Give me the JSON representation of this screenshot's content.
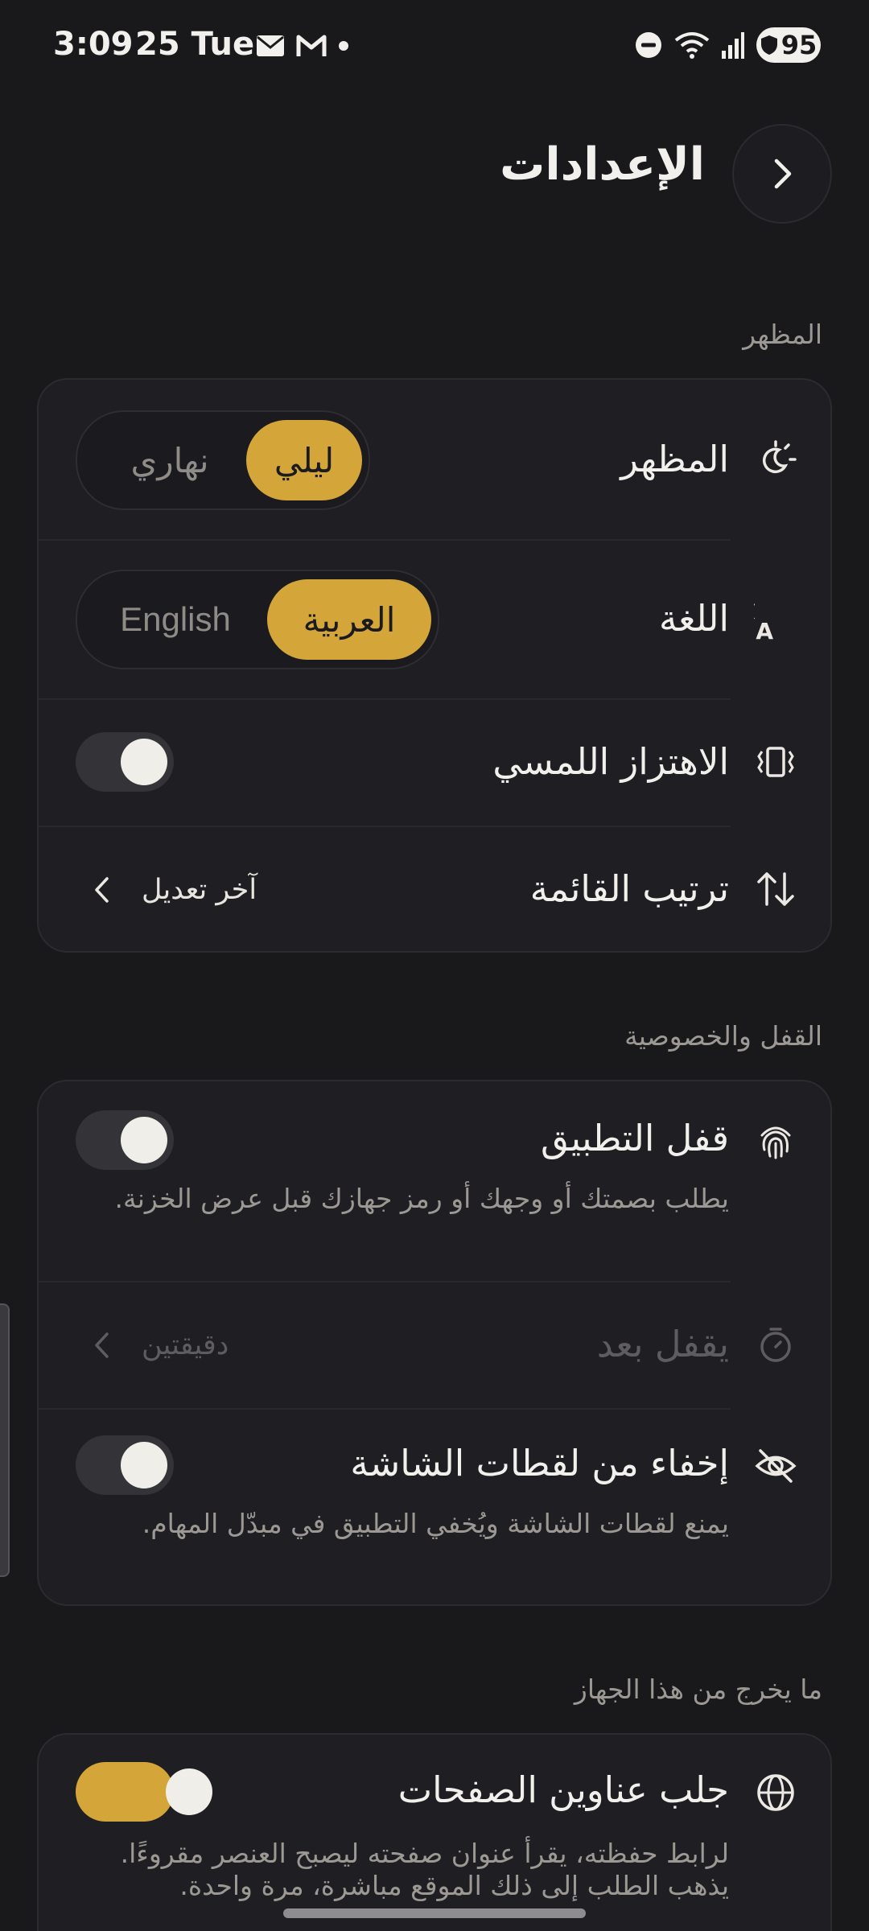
{
  "status_bar": {
    "time": "3:09",
    "date": "25 Tue",
    "battery": "95"
  },
  "header": {
    "title": "الإعدادات"
  },
  "appearance_section": {
    "label": "المظهر",
    "theme": {
      "label": "المظهر",
      "options": [
        "ليلي",
        "نهاري"
      ],
      "selected": "ليلي"
    },
    "language": {
      "label": "اللغة",
      "options": [
        "العربية",
        "English"
      ],
      "selected": "العربية"
    },
    "haptics": {
      "label": "الاهتزاز اللمسي",
      "enabled": false
    },
    "sort": {
      "label": "ترتيب القائمة",
      "value": "آخر تعديل"
    }
  },
  "lock_section": {
    "label": "القفل والخصوصية",
    "app_lock": {
      "label": "قفل التطبيق",
      "description": "يطلب بصمتك أو وجهك أو رمز جهازك قبل عرض الخزنة.",
      "enabled": false
    },
    "lock_after": {
      "label": "يقفل بعد",
      "value": "دقيقتين",
      "disabled": true
    },
    "hide_screenshots": {
      "label": "إخفاء من لقطات الشاشة",
      "description": "يمنع لقطات الشاشة ويُخفي التطبيق في مبدّل المهام.",
      "enabled": false
    }
  },
  "network_section": {
    "label": "ما يخرج من هذا الجهاز",
    "fetch_titles": {
      "label": "جلب عناوين الصفحات",
      "description": "لرابط حفظته، يقرأ عنوان صفحته ليصبح العنصر مقروءًا. يذهب الطلب إلى ذلك الموقع مباشرة، مرة واحدة.",
      "enabled": true
    }
  },
  "colors": {
    "accent": "#d4a63a",
    "background": "#19181b",
    "card": "#1f1e22"
  },
  "icons": {
    "theme": "theme-sun-moon-icon",
    "language": "translate-icon",
    "haptics": "vibration-icon",
    "sort": "sort-arrows-icon",
    "app_lock": "fingerprint-icon",
    "lock_after": "timer-icon",
    "hide_screenshots": "eye-off-icon",
    "fetch_titles": "globe-icon",
    "back": "chevron-right-icon"
  }
}
